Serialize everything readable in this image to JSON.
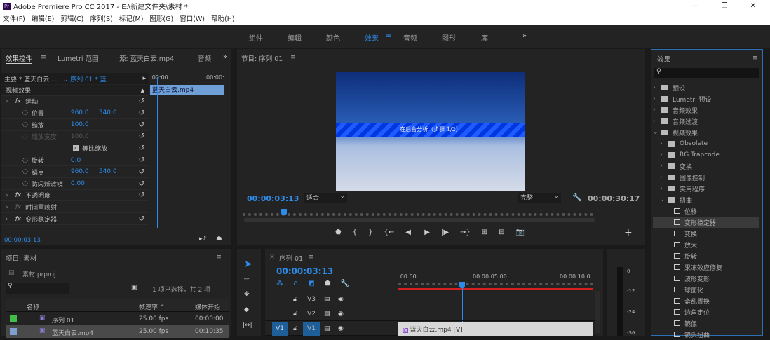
{
  "window": {
    "title": "Adobe Premiere Pro CC 2017 - E:\\新建文件夹\\素材 *",
    "logo": "Pr",
    "controls": [
      "—",
      "❐",
      "✕"
    ]
  },
  "menu": [
    "文件(F)",
    "编辑(E)",
    "剪辑(C)",
    "序列(S)",
    "标记(M)",
    "图形(G)",
    "窗口(W)",
    "帮助(H)"
  ],
  "workspaces": {
    "items": [
      "组件",
      "编辑",
      "颜色",
      "效果",
      "音频",
      "图形",
      "库"
    ],
    "active": "效果",
    "more": "»"
  },
  "effect_controls": {
    "tabs": [
      "效果控件",
      "Lumetri 范围",
      "源: 蓝天白云.mp4",
      "音频"
    ],
    "master": "主要 * 蓝天白云 ...",
    "sequence": "序列 01 * 蓝...",
    "ruler_start": ":00:00",
    "ruler_end": "00:00:",
    "clip": "蓝天白云.mp4",
    "section": "视频效果",
    "rows": [
      {
        "label": "运动",
        "fx": true
      },
      {
        "label": "位置",
        "v1": "960.0",
        "v2": "540.0"
      },
      {
        "label": "缩放",
        "v1": "100.0"
      },
      {
        "label": "缩放宽度",
        "v1": "100.0",
        "disabled": true
      },
      {
        "label": "等比缩放",
        "checkbox": true
      },
      {
        "label": "旋转",
        "v1": "0.0"
      },
      {
        "label": "锚点",
        "v1": "960.0",
        "v2": "540.0"
      },
      {
        "label": "防闪烁滤镜",
        "v1": "0.00"
      },
      {
        "label": "不透明度",
        "fx": true
      },
      {
        "label": "时间重映射",
        "fx": true
      },
      {
        "label": "变形稳定器",
        "fx": true
      }
    ],
    "timecode": "00:00:03:13"
  },
  "program": {
    "title": "节目: 序列 01",
    "overlay": "在后台分析（步骤 1/2）",
    "timecode": "00:00:03:13",
    "zoom": "适合",
    "quality": "完整",
    "duration": "00:00:30:17",
    "playhead_fraction": 0.11
  },
  "effects": {
    "title": "效果",
    "search_placeholder": "",
    "tree": [
      {
        "label": "预设",
        "depth": 0,
        "type": "preset"
      },
      {
        "label": "Lumetri 预设",
        "depth": 0,
        "type": "preset"
      },
      {
        "label": "音频效果",
        "depth": 0,
        "type": "folder"
      },
      {
        "label": "音频过渡",
        "depth": 0,
        "type": "folder"
      },
      {
        "label": "视频效果",
        "depth": 0,
        "type": "folder",
        "open": true
      },
      {
        "label": "Obsolete",
        "depth": 1,
        "type": "folder"
      },
      {
        "label": "RG Trapcode",
        "depth": 1,
        "type": "folder"
      },
      {
        "label": "变换",
        "depth": 1,
        "type": "folder"
      },
      {
        "label": "图像控制",
        "depth": 1,
        "type": "folder"
      },
      {
        "label": "实用程序",
        "depth": 1,
        "type": "folder"
      },
      {
        "label": "扭曲",
        "depth": 1,
        "type": "folder",
        "open": true
      },
      {
        "label": "位移",
        "depth": 2,
        "type": "fx"
      },
      {
        "label": "变形稳定器",
        "depth": 2,
        "type": "fx",
        "selected": true
      },
      {
        "label": "变换",
        "depth": 2,
        "type": "fx"
      },
      {
        "label": "放大",
        "depth": 2,
        "type": "fx"
      },
      {
        "label": "旋转",
        "depth": 2,
        "type": "fx"
      },
      {
        "label": "果冻效应修复",
        "depth": 2,
        "type": "fx"
      },
      {
        "label": "波形变形",
        "depth": 2,
        "type": "fx"
      },
      {
        "label": "球面化",
        "depth": 2,
        "type": "fx"
      },
      {
        "label": "紊乱置换",
        "depth": 2,
        "type": "fx"
      },
      {
        "label": "边角定位",
        "depth": 2,
        "type": "fx"
      },
      {
        "label": "镜像",
        "depth": 2,
        "type": "fx"
      },
      {
        "label": "镜头扭曲",
        "depth": 2,
        "type": "fx"
      }
    ]
  },
  "project": {
    "title": "项目: 素材",
    "file": "素材.prproj",
    "selection": "1 项已选择，共 2 项",
    "columns": [
      "名称",
      "帧速率 ^",
      "媒体开始"
    ],
    "items": [
      {
        "name": "序列 01",
        "fps": "25.00 fps",
        "start": "00:00:00",
        "color": "#3fbf4a"
      },
      {
        "name": "蓝天白云.mp4",
        "fps": "25.00 fps",
        "start": "00:10:35",
        "color": "#7f9fd0",
        "selected": true
      }
    ]
  },
  "timeline": {
    "title": "序列 01",
    "timecode": "00:00:03:13",
    "ruler": [
      ":00:00",
      "00:00:05:00",
      "00:00:10:0"
    ],
    "tracks": [
      "V3",
      "V2",
      "V1"
    ],
    "clip": "蓝天白云.mp4 [V]"
  },
  "meter": {
    "labels": [
      "0",
      "-12",
      "-24",
      "-36"
    ]
  }
}
